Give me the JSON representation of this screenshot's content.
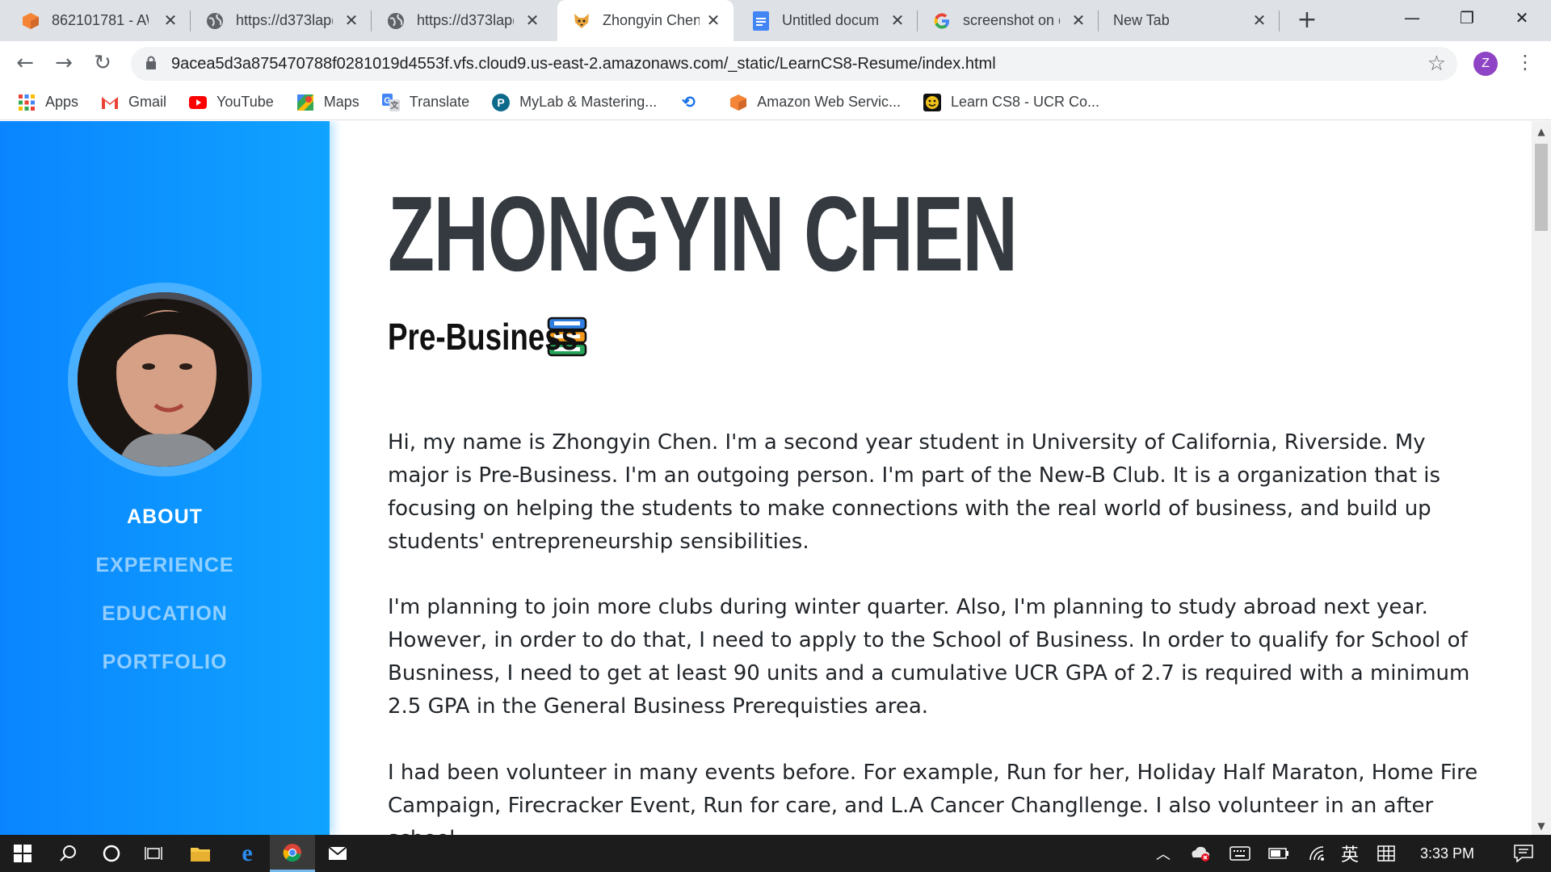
{
  "browser": {
    "tabs": [
      {
        "title": "862101781 - AW",
        "icon": "aws-cube-icon"
      },
      {
        "title": "https://d373lap(",
        "icon": "globe-icon"
      },
      {
        "title": "https://d373lap(",
        "icon": "globe-icon"
      },
      {
        "title": "Zhongyin Chen",
        "icon": "fox-face-icon",
        "active": true
      },
      {
        "title": "Untitled docume",
        "icon": "google-docs-icon"
      },
      {
        "title": "screenshot on d",
        "icon": "google-g-icon"
      },
      {
        "title": "New Tab",
        "icon": ""
      }
    ],
    "url": "9acea5d3a875470788f0281019d4553f.vfs.cloud9.us-east-2.amazonaws.com/_static/LearnCS8-Resume/index.html",
    "profile_initial": "Z",
    "bookmarks": [
      {
        "label": "Apps",
        "icon": "apps-grid-icon"
      },
      {
        "label": "Gmail",
        "icon": "gmail-icon"
      },
      {
        "label": "YouTube",
        "icon": "youtube-icon"
      },
      {
        "label": "Maps",
        "icon": "maps-icon"
      },
      {
        "label": "Translate",
        "icon": "translate-icon"
      },
      {
        "label": "MyLab & Mastering...",
        "icon": "pearson-icon"
      },
      {
        "label": "",
        "icon": "history-icon"
      },
      {
        "label": "Amazon Web Servic...",
        "icon": "aws-cube-icon"
      },
      {
        "label": "Learn CS8 - UCR Co...",
        "icon": "learn-cs8-icon"
      }
    ]
  },
  "sidebar": {
    "nav": [
      {
        "label": "ABOUT",
        "active": true
      },
      {
        "label": "EXPERIENCE",
        "active": false
      },
      {
        "label": "EDUCATION",
        "active": false
      },
      {
        "label": "PORTFOLIO",
        "active": false
      }
    ]
  },
  "main": {
    "name": "ZHONGYIN CHEN",
    "subtitle": "Pre-Business",
    "paragraphs": [
      "Hi, my name is Zhongyin Chen. I'm a second year student in University of California, Riverside. My major is Pre-Business. I'm an outgoing person. I'm part of the New-B Club. It is a organization that is focusing on helping the students to make connections with the real world of business, and build up students' entrepreneurship sensibilities.",
      "I'm planning to join more clubs during winter quarter. Also, I'm planning to study abroad next year. However, in order to do that, I need to apply to the School of Business. In order to qualify for School of Busniness, I need to get at least 90 units and a cumulative UCR GPA of 2.7 is required with a minimum 2.5 GPA in the General Business Prerequisties area.",
      "I had been volunteer in many events before. For example, Run for her, Holiday Half Maraton, Home Fire Campaign, Firecracker Event, Run for care, and L.A Cancer Changllenge. I also volunteer in an after school"
    ]
  },
  "taskbar": {
    "time": "3:33 PM",
    "ime_label": "英"
  }
}
